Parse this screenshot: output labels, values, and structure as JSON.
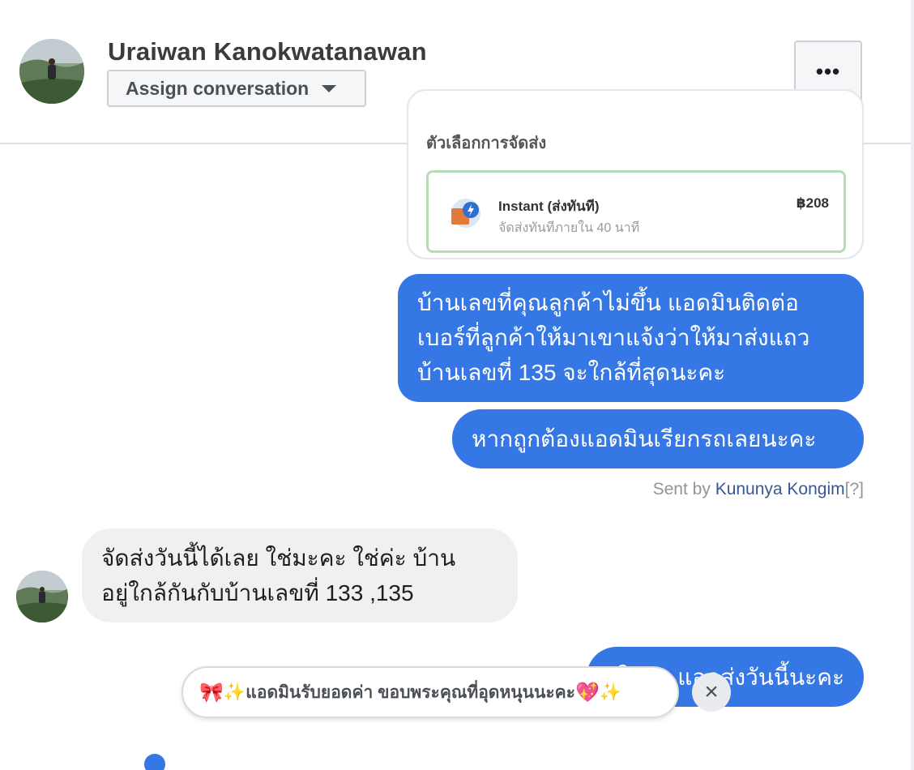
{
  "header": {
    "contact_name": "Uraiwan Kanokwatanawan",
    "assign_label": "Assign conversation",
    "more_label": "•••"
  },
  "shared_card": {
    "cut_title": "ตัวเลือกการจัดส่ง",
    "option_title": "Instant (ส่งทันที)",
    "option_subtitle": "จัดส่งทันทีภายใน 40 นาที",
    "option_price": "฿208"
  },
  "messages": [
    {
      "lines": [
        "บ้านเลขที่คุณลูกค้าไม่ขึ้น แอดมินติดต่อ",
        "เบอร์ที่ลูกค้าให้มาเขาแจ้งว่าให้มาส่งแถว",
        "บ้านเลขที่ 135 จะใกล้ที่สุดนะคะ"
      ]
    },
    {
      "text": "หากถูกต้องแอดมินเรียกรถเลยนะคะ"
    },
    {
      "lines": [
        "จัดส่งวันนี้ได้เลย ใช่มะคะ ใช่ค่ะ บ้าน",
        "อยู่ใกล้กันกับบ้านเลขที่ 133 ,135"
      ]
    },
    {
      "text": "ใช่ค่ะ แอดส่งวันนี้นะคะ"
    }
  ],
  "sent_by": {
    "prefix": "Sent by ",
    "name": "Kununya Kongim",
    "help": "[?]"
  },
  "quick_reply": {
    "bow": "🎀",
    "spark": "✨",
    "text": "แอดมินรับยอดค่า ขอบพระคุณที่อุดหนุนนะคะ",
    "heart": "💖",
    "spark_end": "✨",
    "close": "×"
  },
  "colors": {
    "outgoing_bubble": "#3578e5",
    "incoming_bubble": "#f0f0f0",
    "link": "#365899"
  }
}
